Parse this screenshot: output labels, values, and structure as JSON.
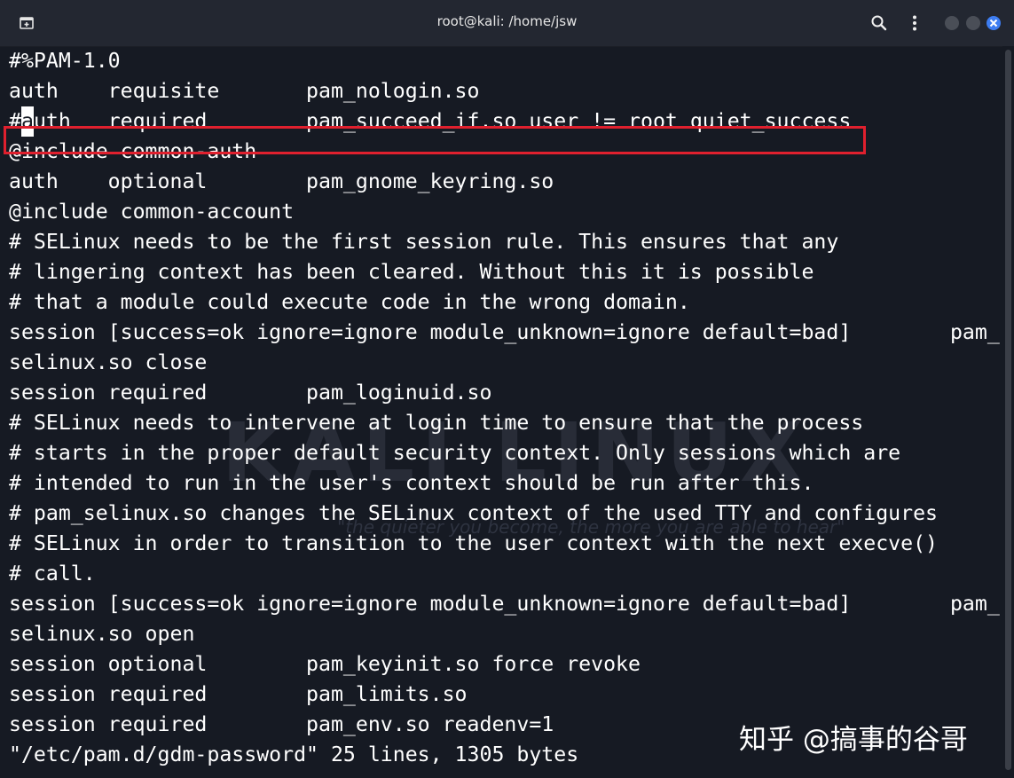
{
  "window": {
    "title": "root@kali: /home/jsw"
  },
  "icons": {
    "new_tab": "new-tab-icon",
    "search": "search-icon",
    "menu": "kebab-menu-icon",
    "minimize": "minimize-icon",
    "maximize": "maximize-icon",
    "close": "close-icon"
  },
  "colors": {
    "terminal_bg": "#161a23",
    "text": "#ffffff",
    "highlight_box": "#e0202e",
    "close_button": "#3d7df2"
  },
  "editor": {
    "cursor_line": 2,
    "cursor_char": "a",
    "highlighted_line": 2,
    "lines": [
      "#%PAM-1.0",
      "auth    requisite       pam_nologin.so",
      "#auth   required        pam_succeed_if.so user != root quiet_success",
      "@include common-auth",
      "auth    optional        pam_gnome_keyring.so",
      "@include common-account",
      "# SELinux needs to be the first session rule. This ensures that any",
      "# lingering context has been cleared. Without this it is possible",
      "# that a module could execute code in the wrong domain.",
      "session [success=ok ignore=ignore module_unknown=ignore default=bad]        pam_",
      "selinux.so close",
      "session required        pam_loginuid.so",
      "# SELinux needs to intervene at login time to ensure that the process",
      "# starts in the proper default security context. Only sessions which are",
      "# intended to run in the user's context should be run after this.",
      "# pam_selinux.so changes the SELinux context of the used TTY and configures",
      "# SELinux in order to transition to the user context with the next execve()",
      "# call.",
      "session [success=ok ignore=ignore module_unknown=ignore default=bad]        pam_",
      "selinux.so open",
      "session optional        pam_keyinit.so force revoke",
      "session required        pam_limits.so",
      "session required        pam_env.so readenv=1"
    ],
    "status_line": "\"/etc/pam.d/gdm-password\" 25 lines, 1305 bytes"
  },
  "watermark": {
    "text": "知乎 @搞事的谷哥"
  }
}
